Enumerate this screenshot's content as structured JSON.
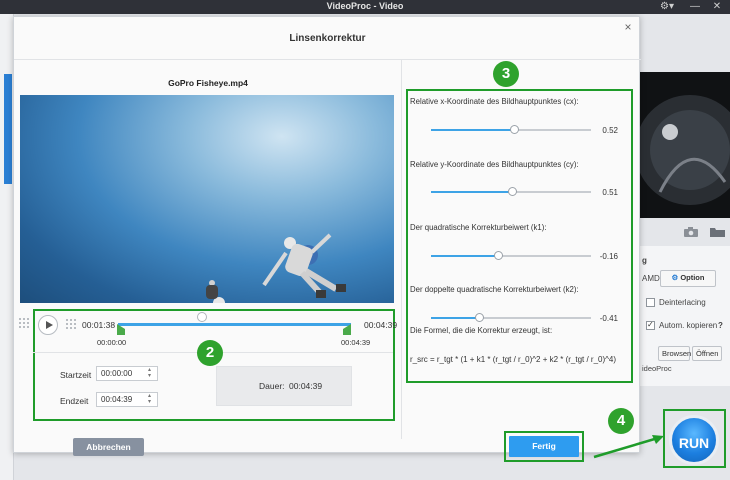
{
  "app": {
    "title": "VideoProc - Video",
    "window_controls": [
      "⚙▾",
      "—",
      "✕"
    ]
  },
  "dialog": {
    "title": "Linsenkorrektur",
    "close_label": "×",
    "file_name": "GoPro Fisheye.mp4"
  },
  "timeline": {
    "current_time": "00:01:38",
    "end_time": "00:04:39",
    "marker_start": "00:00:00",
    "marker_end": "00:04:39",
    "start_label": "Startzeit",
    "start_value": "00:00:00",
    "end_label": "Endzeit",
    "end_value": "00:04:39",
    "duration_label": "Dauer:",
    "duration_value": "00:04:39"
  },
  "sliders": [
    {
      "label": "Relative x-Koordinate des Bildhauptpunktes (cx):",
      "value": "0.52",
      "position": 0.52
    },
    {
      "label": "Relative y-Koordinate des Bildhauptpunktes (cy):",
      "value": "0.51",
      "position": 0.51
    },
    {
      "label": "Der quadratische Korrekturbeiwert (k1):",
      "value": "-0.16",
      "position": 0.42
    },
    {
      "label": "Der doppelte quadratische Korrekturbeiwert (k2):",
      "value": "-0.41",
      "position": 0.3
    }
  ],
  "formula": {
    "label": "Die Formel, die die Korrektur erzeugt, ist:",
    "text": "r_src = r_tgt * (1 + k1 * (r_tgt / r_0)^2 + k2 * (r_tgt / r_0)^4)"
  },
  "buttons": {
    "cancel": "Abbrechen",
    "done": "Fertig",
    "run": "RUN"
  },
  "badges": [
    "2",
    "3",
    "4"
  ],
  "background": {
    "hw_label": "AMD",
    "option_label": "Option",
    "deinterlacing": "Deinterlacing",
    "autocopy": "Autom. kopieren",
    "help": "?",
    "browse": "Browsen",
    "open": "Öffnen",
    "folder_text": "ideoProc",
    "g_label": "g"
  },
  "colors": {
    "accent": "#2e9cf0",
    "highlight_green": "#1f9c2a"
  }
}
